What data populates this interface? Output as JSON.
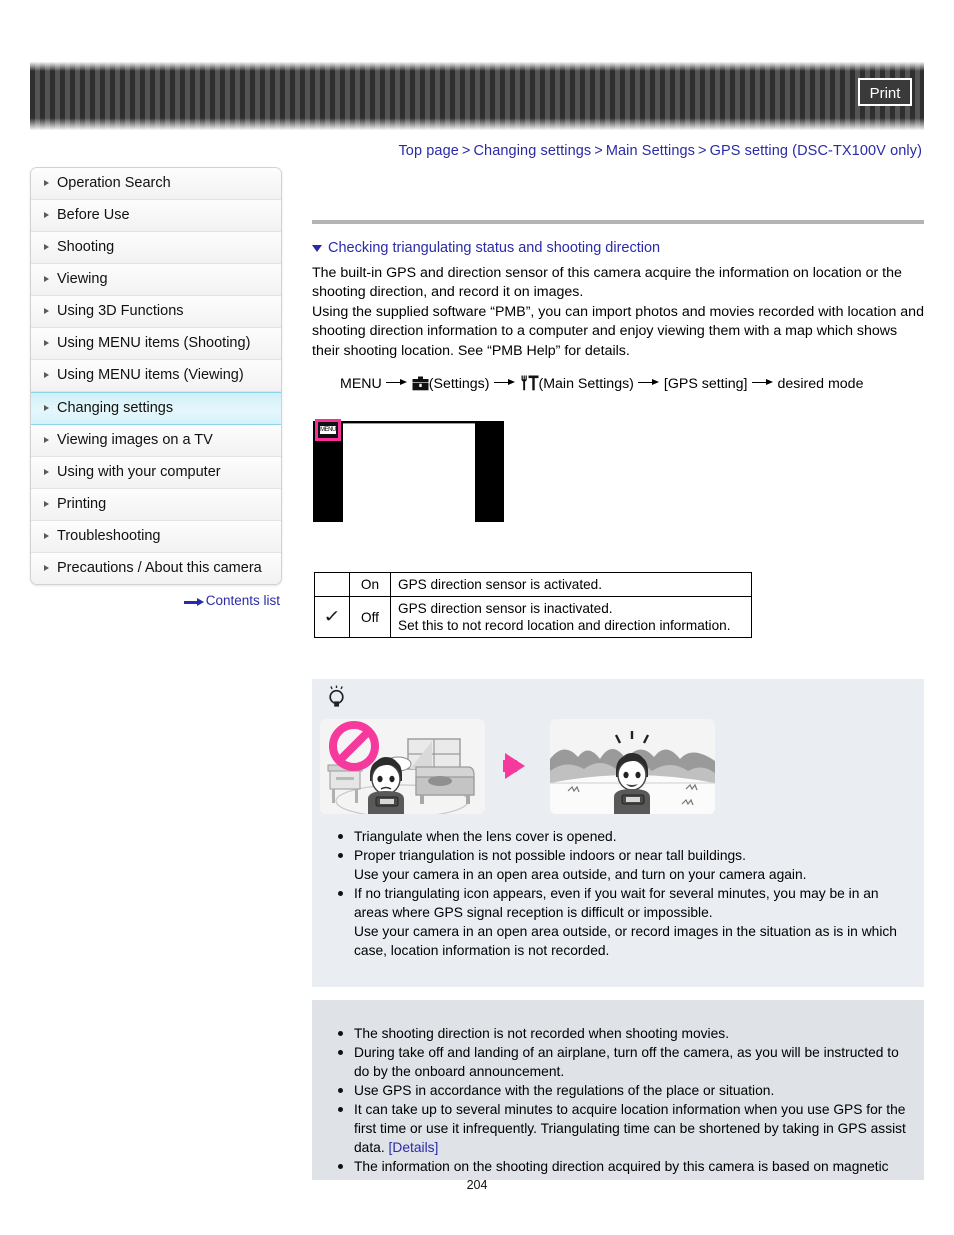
{
  "header": {
    "print_label": "Print"
  },
  "breadcrumb": {
    "items": [
      "Top page",
      "Changing settings",
      "Main Settings",
      "GPS setting (DSC-TX100V only)"
    ],
    "separator": ">"
  },
  "sidebar": {
    "items": [
      {
        "label": "Operation Search",
        "active": false
      },
      {
        "label": "Before Use",
        "active": false
      },
      {
        "label": "Shooting",
        "active": false
      },
      {
        "label": "Viewing",
        "active": false
      },
      {
        "label": "Using 3D Functions",
        "active": false
      },
      {
        "label": "Using MENU items (Shooting)",
        "active": false
      },
      {
        "label": "Using MENU items (Viewing)",
        "active": false
      },
      {
        "label": "Changing settings",
        "active": true
      },
      {
        "label": "Viewing images on a TV",
        "active": false
      },
      {
        "label": "Using with your computer",
        "active": false
      },
      {
        "label": "Printing",
        "active": false
      },
      {
        "label": "Troubleshooting",
        "active": false
      },
      {
        "label": "Precautions / About this camera",
        "active": false
      }
    ],
    "contents_link": "Contents list"
  },
  "main": {
    "section_title": "Checking triangulating status and shooting direction",
    "paragraph_1": "The built-in GPS and direction sensor of this camera acquire the information on location or the shooting direction, and record it on images.",
    "paragraph_2": "Using the supplied software “PMB”, you can import photos and movies recorded with location and shooting direction information to a computer and enjoy viewing them with a map which shows their shooting location. See “PMB Help” for details.",
    "menu_path": {
      "start": "MENU",
      "settings_label": "(Settings)",
      "main_settings_label": "(Main Settings)",
      "item_label": "[GPS setting]",
      "end_label": "desired mode"
    },
    "camera_screen": {
      "menu_chip_label": "MENU"
    },
    "table": {
      "rows": [
        {
          "checked": "",
          "value": "On",
          "description_1": "GPS direction sensor is activated.",
          "description_2": ""
        },
        {
          "checked": "✓",
          "value": "Off",
          "description_1": "GPS direction sensor is inactivated.",
          "description_2": "Set this to not record location and direction information."
        }
      ]
    },
    "tip_box": {
      "bullets": [
        "Triangulate when the lens cover is opened.",
        "Proper triangulation is not possible indoors or near tall buildings.\nUse your camera in an open area outside, and turn on your camera again.",
        "If no triangulating icon appears, even if you wait for several minutes, you may be in an areas where GPS signal reception is difficult or impossible.\nUse your camera in an open area outside, or record images in the situation as is in which case, location information is not recorded."
      ]
    },
    "notes_box": {
      "bullets": [
        "The shooting direction is not recorded when shooting movies.",
        "During take off and landing of an airplane, turn off the camera, as you will be instructed to do by the onboard announcement.",
        "Use GPS in accordance with the regulations of the place or situation.",
        "It can take up to several minutes to acquire location information when you use GPS for the first time or use it infrequently. Triangulating time can be shortened by taking in GPS assist data. [Details]",
        "The information on the shooting direction acquired by this camera is based on magnetic"
      ],
      "details_label": "[Details]"
    }
  },
  "footer": {
    "page_number": "204"
  },
  "colors": {
    "link": "#2a2aa8",
    "accent_pink": "#f6399c",
    "active_nav": "#cfeff8",
    "tip_bg": "#eaedf2",
    "notes_bg": "#dfe2e7"
  }
}
